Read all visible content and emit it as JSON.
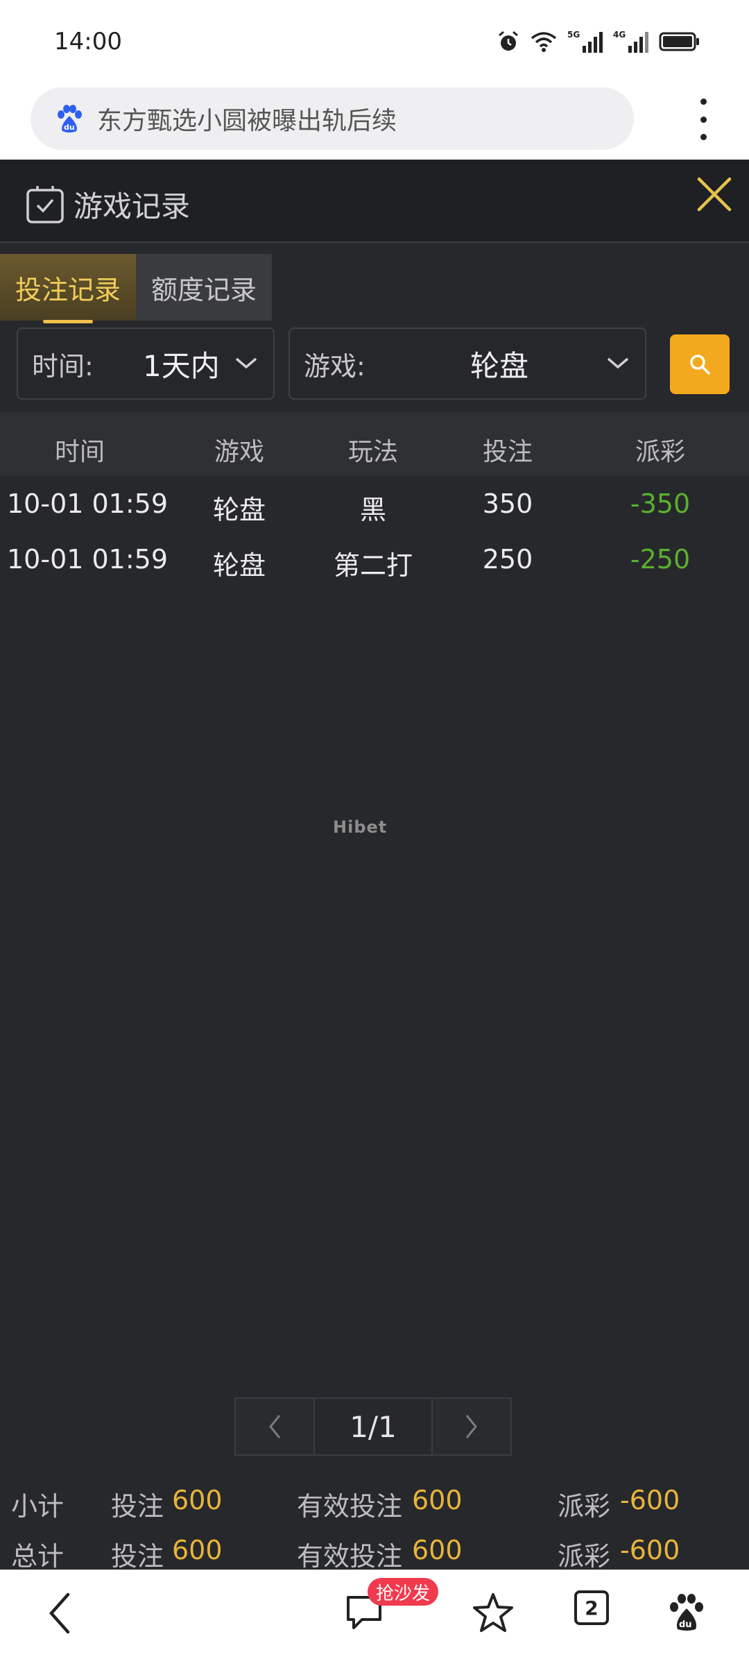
{
  "status_bar": {
    "time": "14:00",
    "icons": [
      "alarm-icon",
      "wifi-icon",
      "signal-5g-icon",
      "signal-4g-icon",
      "battery-icon"
    ]
  },
  "browser": {
    "search_query": "东方甄选小圆被曝出轨后续",
    "logo": "baidu-logo-icon",
    "menu": "more-vertical-icon"
  },
  "panel": {
    "title": "游戏记录",
    "tabs": [
      {
        "label": "投注记录",
        "active": true
      },
      {
        "label": "额度记录",
        "active": false
      }
    ],
    "filters": {
      "time_label": "时间:",
      "time_value": "1天内",
      "game_label": "游戏:",
      "game_value": "轮盘"
    },
    "table": {
      "headers": [
        "时间",
        "游戏",
        "玩法",
        "投注",
        "派彩"
      ],
      "rows": [
        [
          "10-01 01:59",
          "轮盘",
          "黑",
          "350",
          "-350"
        ],
        [
          "10-01 01:59",
          "轮盘",
          "第二打",
          "250",
          "-250"
        ]
      ]
    },
    "watermark": "Hibet",
    "pagination": {
      "page": "1/1"
    },
    "summary": [
      {
        "label": "小计",
        "bet_label": "投注",
        "bet": "600",
        "valid_label": "有效投注",
        "valid": "600",
        "payout_label": "派彩",
        "payout": "-600"
      },
      {
        "label": "总计",
        "bet_label": "投注",
        "bet": "600",
        "valid_label": "有效投注",
        "valid": "600",
        "payout_label": "派彩",
        "payout": "-600"
      }
    ]
  },
  "bottom_nav": {
    "comment_badge": "抢沙发",
    "tab_count": "2"
  },
  "colors": {
    "accent": "#f3a91d",
    "active_tab_text": "#f3cd5a",
    "negative": "#5bb02f",
    "badge": "#f23a4f"
  }
}
